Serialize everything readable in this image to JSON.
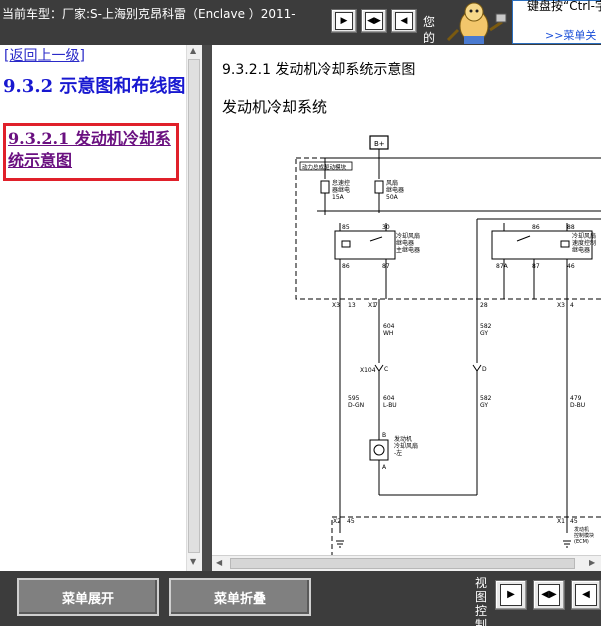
{
  "header": {
    "car_label": "当前车型：厂家:S-上海别克昂科雷（Enclave ）2011-",
    "hint_fragment": "您的服务",
    "tip_text": "键盘按“Ctrl-字！",
    "tip_link": ">>菜单关",
    "nav_buttons": [
      {
        "name": "next-page-button",
        "glyph": "▶"
      },
      {
        "name": "expand-both-button",
        "glyph": "◀▶"
      },
      {
        "name": "prev-page-button",
        "glyph": "◀"
      }
    ]
  },
  "sidebar": {
    "back_link": "[返回上一级]",
    "section_title": "9.3.2 示意图和布线图",
    "current_item": "9.3.2.1 发动机冷却系统示意图"
  },
  "document": {
    "heading": "9.3.2.1 发动机冷却系统示意图",
    "subheading": "发动机冷却系统"
  },
  "diagram": {
    "battery_label": "B+",
    "box_label": "动力总成驱动模块",
    "fuse1_label": [
      "巡速控",
      "风扇继",
      "15A"
    ],
    "fuse1_lines": [
      "怠速控",
      "器继电",
      "15A"
    ],
    "fuse2_lines": [
      "风扇",
      "继电器",
      "50A"
    ],
    "relay1_lines": [
      "冷却风扇",
      "继电器",
      "主继电器"
    ],
    "relay2_lines": [
      "冷却风扇",
      "速度控制",
      "继电器"
    ],
    "pins_top": [
      "85",
      "30",
      "86",
      "88"
    ],
    "pins_bottom": [
      "86",
      "87",
      "87A",
      "87",
      "46"
    ],
    "connector_pins": [
      "X3",
      "13",
      "X1",
      "7",
      "28",
      "X3",
      "4"
    ],
    "wire_labels": [
      "604",
      "WH",
      "582",
      "GY"
    ],
    "splice_label": "X104",
    "splice_pins": [
      "C",
      "D"
    ],
    "wire_labels2": [
      "595",
      "D-GN",
      "604",
      "L-BU",
      "582",
      "GY",
      "479",
      "D-BU"
    ],
    "motor_lines": [
      "发动机",
      "冷却风扇",
      "-左"
    ],
    "motor_pins": [
      "B",
      "A"
    ],
    "bottom_conn": [
      "X2",
      "45",
      "X1",
      "45"
    ],
    "ecm_lines": [
      "发动机",
      "控制模块",
      "(ECM)"
    ]
  },
  "footer": {
    "expand_menu": "菜单展开",
    "collapse_menu": "菜单折叠",
    "view_control": "视图控制",
    "nav_buttons": [
      {
        "name": "next-page-button",
        "glyph": "▶"
      },
      {
        "name": "expand-both-button",
        "glyph": "◀▶"
      },
      {
        "name": "prev-page-button",
        "glyph": "◀"
      }
    ]
  },
  "colors": {
    "chrome_bg": "#3c3c3c",
    "link": "#2a2ac8",
    "section_title": "#1818d0",
    "current_highlight_border": "#e0202a",
    "current_item_text": "#6a1080"
  }
}
